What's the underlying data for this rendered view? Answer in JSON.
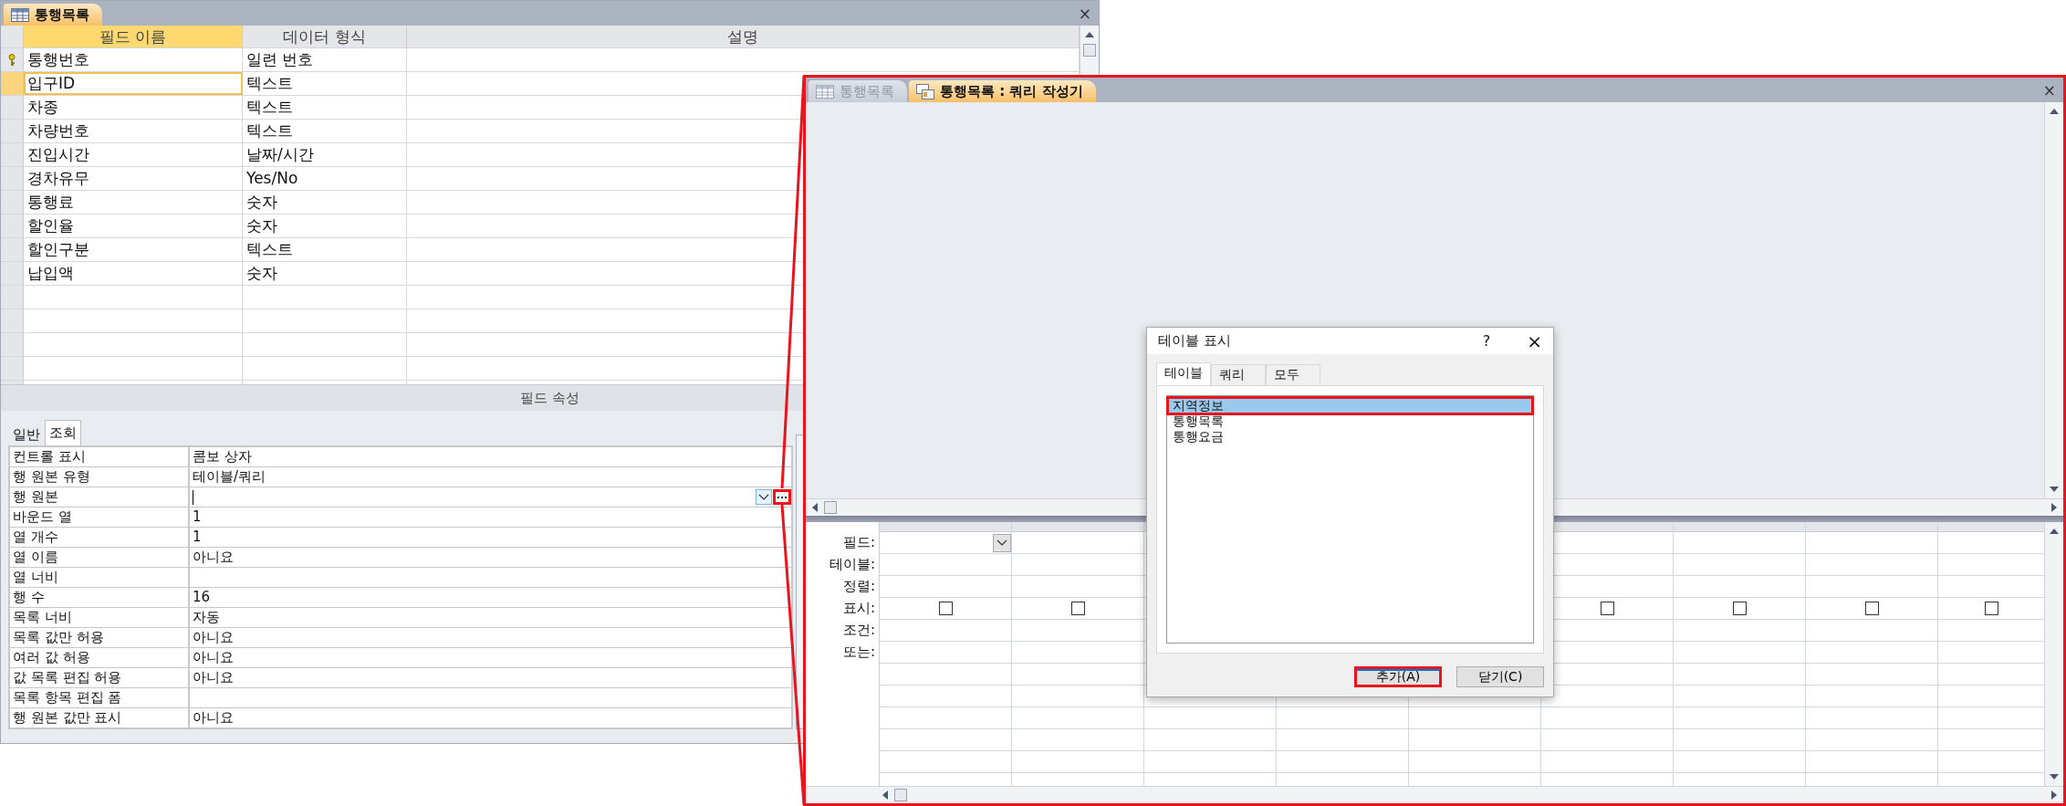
{
  "table_window": {
    "tab": {
      "title": "통행목록",
      "selected": true
    },
    "close": "×",
    "columns": [
      {
        "label": "필드 이름",
        "selected": true
      },
      {
        "label": "데이터 형식",
        "selected": false
      },
      {
        "label": "설명",
        "selected": false
      }
    ],
    "rows": [
      {
        "field": "통행번호",
        "type": "일련 번호",
        "primary_key": true,
        "selected": false
      },
      {
        "field": "입구ID",
        "type": "텍스트",
        "primary_key": false,
        "selected": true
      },
      {
        "field": "차종",
        "type": "텍스트",
        "primary_key": false,
        "selected": false
      },
      {
        "field": "차량번호",
        "type": "텍스트",
        "primary_key": false,
        "selected": false
      },
      {
        "field": "진입시간",
        "type": "날짜/시간",
        "primary_key": false,
        "selected": false
      },
      {
        "field": "경차유무",
        "type": "Yes/No",
        "primary_key": false,
        "selected": false
      },
      {
        "field": "통행료",
        "type": "숫자",
        "primary_key": false,
        "selected": false
      },
      {
        "field": "할인율",
        "type": "숫자",
        "primary_key": false,
        "selected": false
      },
      {
        "field": "할인구분",
        "type": "텍스트",
        "primary_key": false,
        "selected": false
      },
      {
        "field": "납입액",
        "type": "숫자",
        "primary_key": false,
        "selected": false
      }
    ],
    "field_properties": {
      "title": "필드 속성",
      "tabs": [
        {
          "label": "일반",
          "selected": false
        },
        {
          "label": "조회",
          "selected": true
        }
      ],
      "rows": [
        {
          "kind": "text",
          "label": "컨트롤 표시",
          "value": "콤보 상자"
        },
        {
          "kind": "text",
          "label": "행 원본 유형",
          "value": "테이블/쿼리"
        },
        {
          "kind": "combo",
          "label": "행 원본",
          "builder": "...",
          "annotated": true
        },
        {
          "kind": "text",
          "label": "바운드 열",
          "value": "1"
        },
        {
          "kind": "text",
          "label": "열 개수",
          "value": "1"
        },
        {
          "kind": "text",
          "label": "열 이름",
          "value": "아니요"
        },
        {
          "kind": "text",
          "label": "열 너비"
        },
        {
          "kind": "text",
          "label": "행 수",
          "value": "16"
        },
        {
          "kind": "text",
          "label": "목록 너비",
          "value": "자동"
        },
        {
          "kind": "text",
          "label": "목록 값만 허용",
          "value": "아니요"
        },
        {
          "kind": "text",
          "label": "여러 값 허용",
          "value": "아니요"
        },
        {
          "kind": "text",
          "label": "값 목록 편집 허용",
          "value": "아니요"
        },
        {
          "kind": "text",
          "label": "목록 항목 편집 폼"
        },
        {
          "kind": "text",
          "label": "행 원본 값만 표시",
          "value": "아니요"
        }
      ]
    }
  },
  "query_window": {
    "tabs": [
      {
        "label": "통행목록",
        "selected": false
      },
      {
        "label": "통행목록 : 쿼리 작성기",
        "selected": true
      }
    ],
    "close": "×",
    "grid_labels": [
      "필드:",
      "테이블:",
      "정렬:",
      "표시:",
      "조건:",
      "또는:"
    ],
    "grid_columns": [
      {
        "active": true,
        "show": false
      },
      {
        "active": false,
        "show": false
      },
      {
        "active": false,
        "show": false
      },
      {
        "active": false,
        "show": false
      },
      {
        "active": false,
        "show": false
      },
      {
        "active": false,
        "show": false
      }
    ]
  },
  "dialog": {
    "title": "테이블 표시",
    "help": "?",
    "close": "×",
    "tabs": [
      {
        "label": "테이블",
        "selected": true
      },
      {
        "label": "쿼리",
        "selected": false
      },
      {
        "label": "모두",
        "selected": false
      }
    ],
    "items": [
      {
        "label": "지역정보",
        "selected": true,
        "annotated": true
      },
      {
        "label": "통행목록",
        "selected": false,
        "annotated": false
      },
      {
        "label": "통행요금",
        "selected": false,
        "annotated": false
      }
    ],
    "buttons": [
      {
        "label": "추가(A)",
        "default": true,
        "annotated": true
      },
      {
        "label": "닫기(C)",
        "default": false,
        "annotated": false
      }
    ]
  }
}
